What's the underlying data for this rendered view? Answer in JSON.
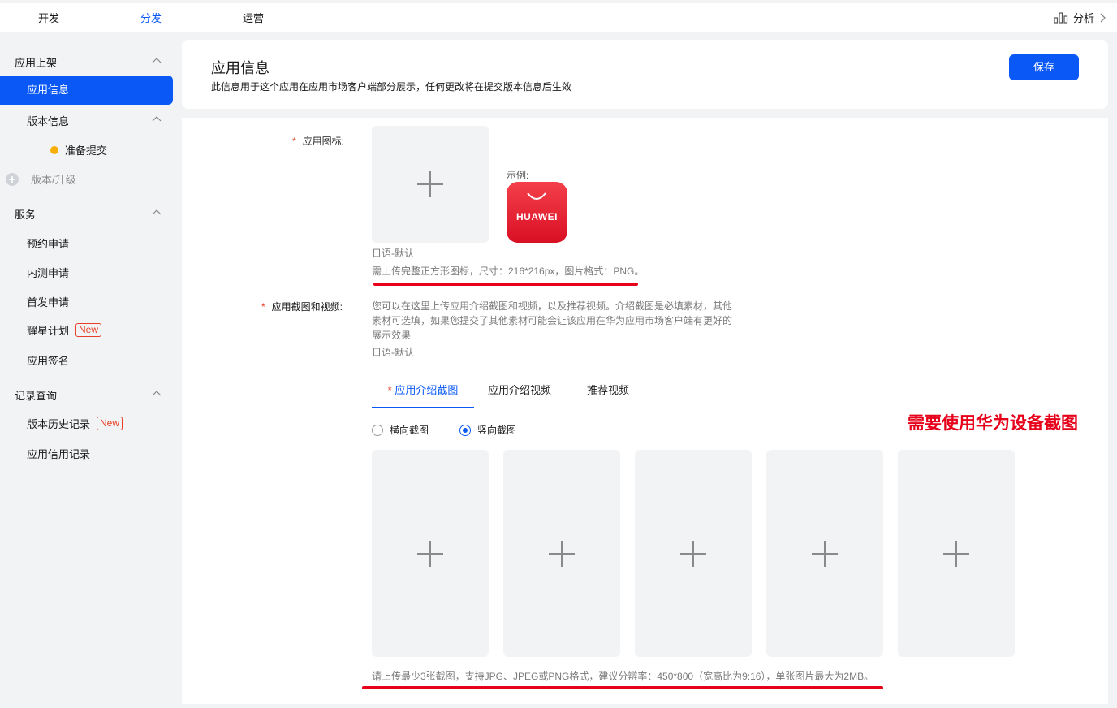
{
  "topnav": {
    "tabs": [
      {
        "label": "开发"
      },
      {
        "label": "分发"
      },
      {
        "label": "运营"
      }
    ],
    "analysis_label": "分析"
  },
  "sidebar": {
    "group_publish": "应用上架",
    "app_info": "应用信息",
    "version_info": "版本信息",
    "ready_submit": "准备提交",
    "version_upgrade": "版本/升级",
    "group_service": "服务",
    "reservation": "预约申请",
    "beta": "内测申请",
    "first_launch": "首发申请",
    "star_plan": "耀星计划",
    "app_signing": "应用签名",
    "group_records": "记录查询",
    "version_history": "版本历史记录",
    "credit_records": "应用信用记录",
    "new_badge": "New"
  },
  "header": {
    "title": "应用信息",
    "subtitle": "此信息用于这个应用在应用市场客户端部分展示，任何更改将在提交版本信息后生效",
    "save_label": "保存"
  },
  "form": {
    "required_mark": "*",
    "icon_label": "应用图标:",
    "example_label": "示例:",
    "example_logo_text": "HUAWEI",
    "icon_locale": "日语-默认",
    "icon_hint": "需上传完整正方形图标，尺寸：216*216px，图片格式：PNG。",
    "screens_label": "应用截图和视频:",
    "screens_desc_1": "您可以在这里上传应用介绍截图和视频，以及推荐视频。介绍截图是必填素材，其他",
    "screens_desc_2": "素材可选填，如果您提交了其他素材可能会让该应用在华为应用市场客户端有更好的",
    "screens_desc_3": "展示效果",
    "screens_locale": "日语-默认",
    "media_tabs": [
      {
        "label": "应用介绍截图"
      },
      {
        "label": "应用介绍视频"
      },
      {
        "label": "推荐视频"
      }
    ],
    "orientation_landscape": "横向截图",
    "orientation_portrait": "竖向截图",
    "orientation_selected": "竖向截图",
    "screens_hint": "请上传最少3张截图，支持JPG、JPEG或PNG格式，建议分辨率：450*800（宽高比为9:16），单张图片最大为2MB。"
  },
  "annotation": {
    "text": "需要使用华为设备截图",
    "color": "#e6001a"
  },
  "colors": {
    "accent": "#0a59f7",
    "required": "#e84026",
    "dot": "#f7ae00"
  }
}
